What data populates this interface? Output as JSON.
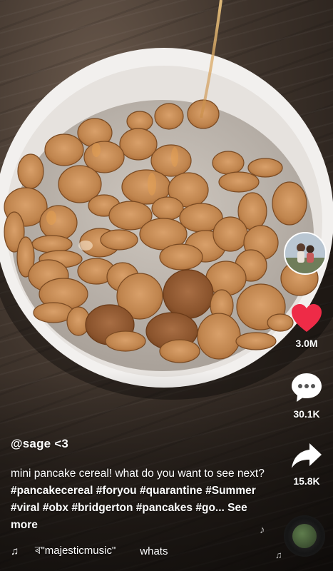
{
  "creator": {
    "username": "@sage <3"
  },
  "caption": {
    "text": "mini pancake cereal! what do you want to see next?",
    "hashtags": [
      "#pancakecereal",
      "#foryou",
      "#quarantine",
      "#Summer",
      "#viral",
      "#obx",
      "#bridgerton",
      "#pancakes",
      "#go..."
    ],
    "see_more": "See more"
  },
  "sound": {
    "label": "♫",
    "track_text": "ৰ\"majesticmusic\"",
    "scroll_text": "whats"
  },
  "actions": {
    "like": {
      "icon": "heart-icon",
      "count": "3.0M",
      "color": "#ee2b47"
    },
    "comment": {
      "icon": "comment-bubble-icon",
      "count": "30.1K"
    },
    "share": {
      "icon": "share-arrow-icon",
      "count": "15.8K"
    }
  },
  "colors": {
    "like": "#ee2b47",
    "text": "#ffffff"
  }
}
